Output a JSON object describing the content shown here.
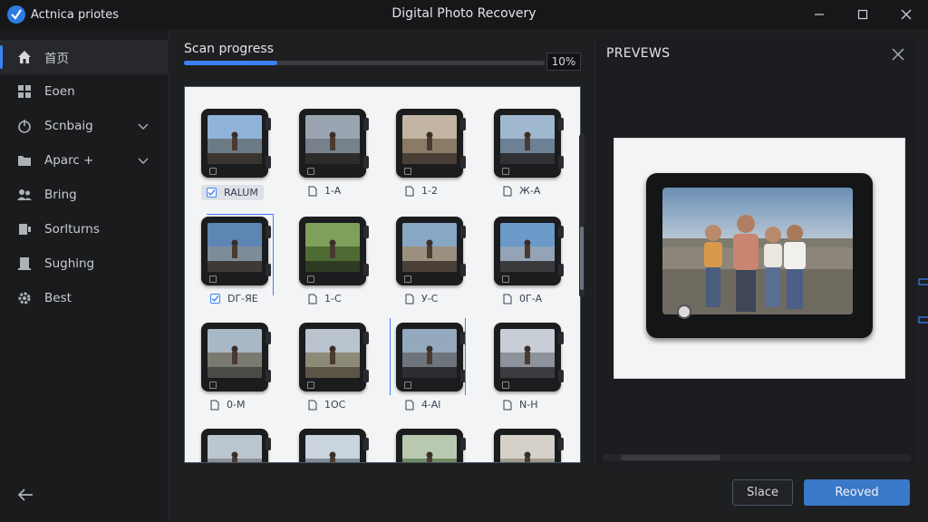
{
  "app": {
    "brand": "Actnica priotes",
    "window_title": "Digital Photo Recovery"
  },
  "colors": {
    "accent": "#3b82f6",
    "primary_button": "#3a78c8",
    "bg": "#1e1f21"
  },
  "sidebar": {
    "items": [
      {
        "label": "首页",
        "icon": "home-icon",
        "active": true
      },
      {
        "label": "Eoen",
        "icon": "grid-icon"
      },
      {
        "label": "Scnbaig",
        "icon": "power-icon",
        "chevron": true
      },
      {
        "label": "Aparc +",
        "icon": "folder-icon",
        "chevron": true
      },
      {
        "label": "Bring",
        "icon": "users-icon"
      },
      {
        "label": "Sorlturns",
        "icon": "device-icon"
      },
      {
        "label": "Sughing",
        "icon": "clipboard-icon"
      },
      {
        "label": "Best",
        "icon": "gear-icon"
      }
    ],
    "back_icon": "arrow-left-icon"
  },
  "scan": {
    "label": "Scan progress",
    "percent_text": "10%",
    "percent": 0.26
  },
  "grid": {
    "items": [
      {
        "caption": "RALUM",
        "checked": true,
        "selected": true
      },
      {
        "caption": "1-A"
      },
      {
        "caption": "1-2"
      },
      {
        "caption": "Ж-А"
      },
      {
        "caption": "DГ-ЯЕ",
        "checked": true
      },
      {
        "caption": "1-C"
      },
      {
        "caption": "У-С"
      },
      {
        "caption": "0Г-А"
      },
      {
        "caption": "0-М"
      },
      {
        "caption": "1ОС"
      },
      {
        "caption": "4-Al"
      },
      {
        "caption": "N-Н"
      },
      {
        "caption": ""
      },
      {
        "caption": ""
      },
      {
        "caption": ""
      },
      {
        "caption": ""
      }
    ]
  },
  "preview": {
    "title": "PREVEWS",
    "close_icon": "close-icon"
  },
  "footer": {
    "secondary_label": "Slace",
    "primary_label": "Reoved"
  }
}
